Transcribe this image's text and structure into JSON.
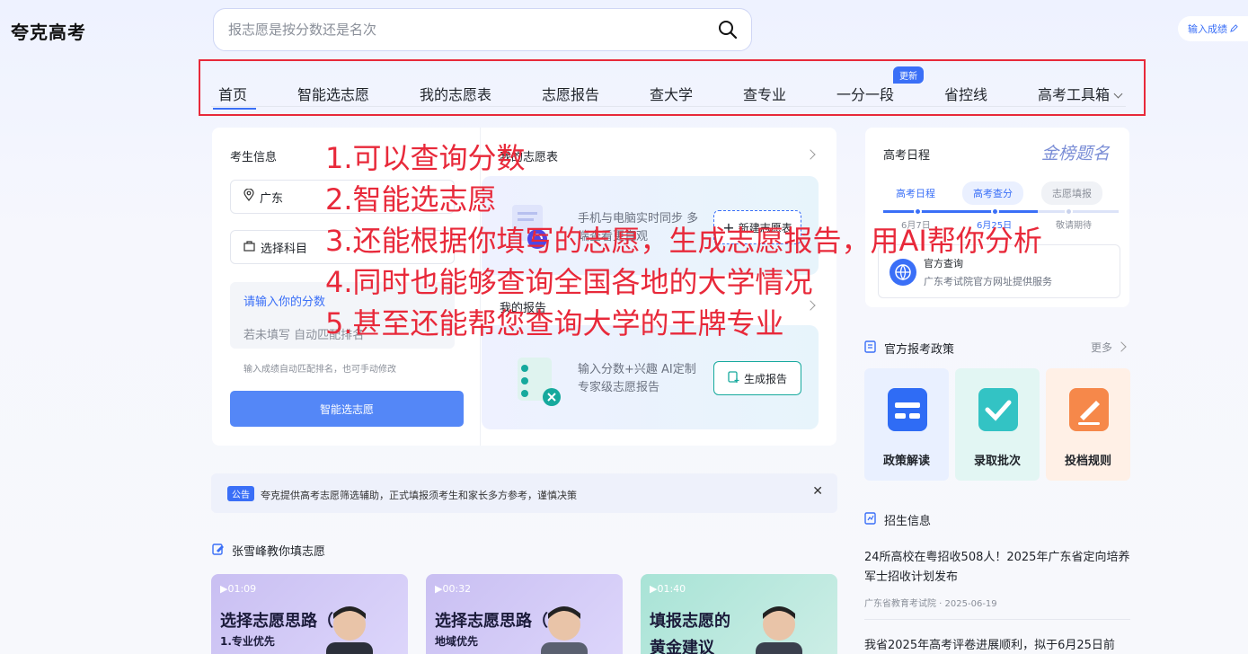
{
  "app": {
    "brand": "夸克高考"
  },
  "search": {
    "placeholder": "报志愿是按分数还是名次"
  },
  "header": {
    "score_button": "输入成绩"
  },
  "nav": {
    "items": [
      "首页",
      "智能选志愿",
      "我的志愿表",
      "志愿报告",
      "查大学",
      "查专业",
      "一分一段",
      "省控线",
      "高考工具箱"
    ],
    "badge": "更新"
  },
  "student": {
    "title": "考生信息",
    "province": "广东",
    "subject": "选择科目",
    "score_label": "请输入你的分数",
    "rank_placeholder": "若未填写 自动匹配排名",
    "hint": "输入成绩自动匹配排名，也可手动修改",
    "submit": "智能选志愿"
  },
  "my_table": {
    "title": "我的志愿表",
    "desc": "手机与电脑实时同步 多端查看更直观",
    "button": "新建志愿表"
  },
  "my_report": {
    "title": "我的报告",
    "desc": "输入分数+兴趣 AI定制专家级志愿报告",
    "button": "生成报告"
  },
  "notice": {
    "tag": "公告",
    "text": "夸克提供高考志愿筛选辅助，正式填报须考生和家长多方参考，谨慎决策"
  },
  "videos": {
    "section_title": "张雪峰教你填志愿",
    "items": [
      {
        "duration": "01:09",
        "title": "选择志愿思路（上）",
        "subtitle": "1.专业优先"
      },
      {
        "duration": "00:32",
        "title": "选择志愿思路（下）",
        "subtitle": "地域优先"
      },
      {
        "duration": "01:40",
        "title": "填报志愿的",
        "subtitle": "黄金建议"
      }
    ]
  },
  "schedule": {
    "title": "高考日程",
    "logo": "金榜题名",
    "tabs": [
      "高考日程",
      "高考查分",
      "志愿填报"
    ],
    "dates": [
      "6月7日",
      "6月25日",
      "敬请期待"
    ],
    "official_title": "官方查询",
    "official_desc": "广东考试院官方网址提供服务"
  },
  "policy": {
    "title": "官方报考政策",
    "more": "更多",
    "tiles": [
      "政策解读",
      "录取批次",
      "投档规则"
    ]
  },
  "admission": {
    "title": "招生信息",
    "news": [
      {
        "title": "24所高校在粤招收508人！2025年广东省定向培养军士招收计划发布",
        "source": "广东省教育考试院 · 2025-06-19"
      },
      {
        "title": "我省2025年高考评卷进展顺利，拟于6月25日前"
      }
    ]
  },
  "annotations": [
    "1.可以查询分数",
    "2.智能选志愿",
    "3.还能根据你填写的志愿，生成志愿报告，用AI帮你分析",
    "4.同时也能够查询全国各地的大学情况",
    "5.甚至还能帮您查询大学的王牌专业"
  ],
  "colors": {
    "accent": "#3a6ff7",
    "annotation": "#e8293a",
    "teal": "#16a99d"
  }
}
